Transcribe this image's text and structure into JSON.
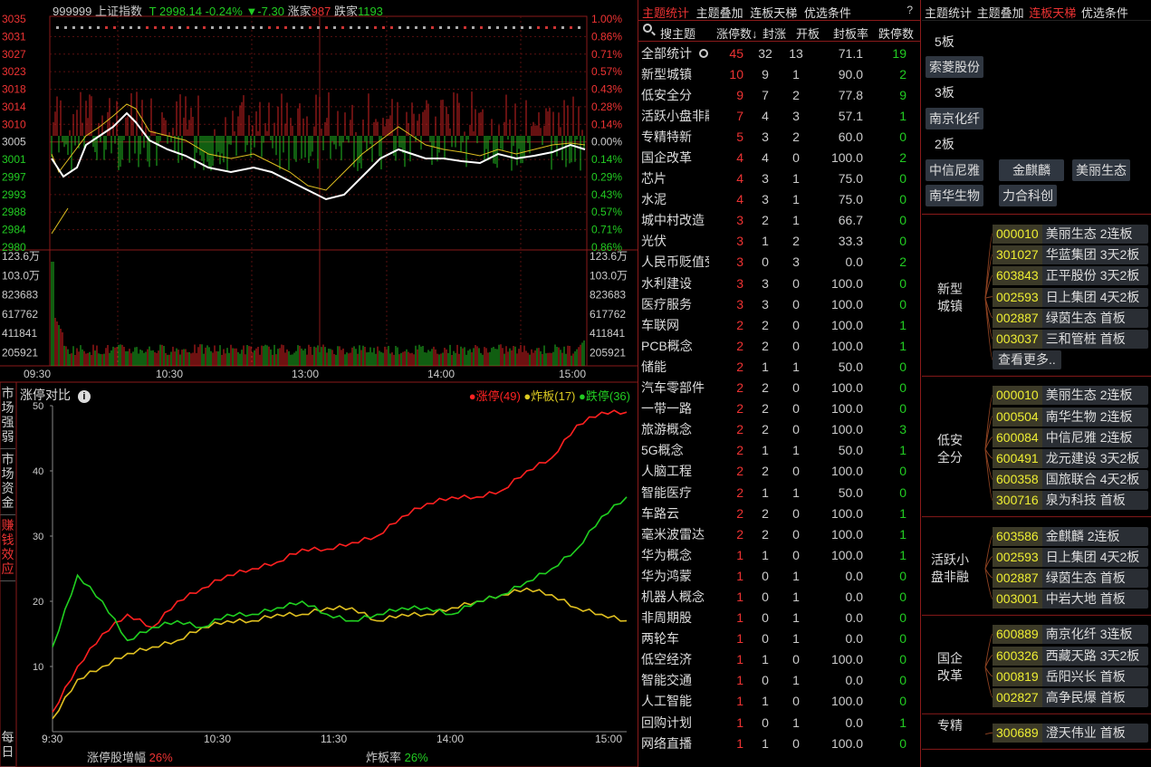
{
  "top_header": {
    "code": "999999",
    "name": "上证指数",
    "t": "T",
    "price": "2998.14",
    "pct": "-0.24%",
    "arrow": "▼",
    "chg": "-7.30",
    "up_label": "涨家",
    "up_count": "987",
    "down_label": "跌家",
    "down_count": "1193"
  },
  "price_axis": {
    "left": [
      "3035",
      "3031",
      "3027",
      "3023",
      "3018",
      "3014",
      "3010",
      "3005",
      "3001",
      "2997",
      "2993",
      "2988",
      "2984",
      "2980"
    ],
    "right": [
      "1.00%",
      "0.86%",
      "0.71%",
      "0.57%",
      "0.43%",
      "0.28%",
      "0.14%",
      "0.00%",
      "0.14%",
      "0.29%",
      "0.43%",
      "0.57%",
      "0.71%",
      "0.86%"
    ]
  },
  "volume_axis": {
    "left": [
      "123.6万",
      "103.0万",
      "823683",
      "617762",
      "411841",
      "205921"
    ],
    "right": [
      "123.6万",
      "103.0万",
      "823683",
      "617762",
      "411841",
      "205921"
    ]
  },
  "time_axis": [
    "09:30",
    "10:30",
    "13:00",
    "14:00",
    "15:00"
  ],
  "vtabs": [
    {
      "label": "市场强弱"
    },
    {
      "label": "市场资金"
    },
    {
      "label": "赚钱效应"
    },
    {
      "label": "每日"
    }
  ],
  "compare": {
    "title": "涨停对比",
    "legend": [
      {
        "name": "涨停(49)",
        "color": "#ff2020"
      },
      {
        "name": "炸板(17)",
        "color": "#e0c020"
      },
      {
        "name": "跌停(36)",
        "color": "#20d020"
      }
    ],
    "footer_left_label": "涨停股增幅",
    "footer_left_value": "26%",
    "footer_right_label": "炸板率",
    "footer_right_value": "26%"
  },
  "chart_data": {
    "type": "line",
    "title": "涨停对比",
    "x": [
      "9:30",
      "10:30",
      "11:30",
      "14:00",
      "15:00"
    ],
    "ylim": [
      0,
      50
    ],
    "yticks": [
      "10",
      "20",
      "30",
      "40",
      "50"
    ],
    "series": [
      {
        "name": "涨停(49)",
        "color": "#ff2020",
        "values": [
          3,
          10,
          15,
          18,
          16,
          20,
          22,
          24,
          25,
          26,
          28,
          28,
          29,
          30,
          33,
          35,
          36,
          36,
          37,
          40,
          42,
          47,
          49,
          49
        ]
      },
      {
        "name": "炸板(17)",
        "color": "#e0c020",
        "values": [
          2,
          8,
          10,
          12,
          13,
          14,
          16,
          17,
          17,
          18,
          18,
          19,
          19,
          17,
          18,
          18,
          19,
          20,
          21,
          22,
          21,
          19,
          18,
          17
        ]
      },
      {
        "name": "跌停(36)",
        "color": "#20d020",
        "values": [
          13,
          24,
          20,
          14,
          16,
          17,
          16,
          18,
          18,
          19,
          20,
          18,
          17,
          18,
          19,
          19,
          18,
          20,
          21,
          23,
          25,
          28,
          33,
          36
        ]
      }
    ]
  },
  "theme_panel": {
    "tabs": [
      "主题统计",
      "主题叠加",
      "连板天梯",
      "优选条件"
    ],
    "help": "?",
    "search_placeholder": "搜主题",
    "columns": [
      "涨停数↓",
      "封涨",
      "开板",
      "封板率",
      "跌停数"
    ],
    "rows": [
      {
        "name": "全部统计",
        "a": "45",
        "b": "32",
        "c": "13",
        "d": "71.1",
        "e": "19"
      },
      {
        "name": "新型城镇",
        "a": "10",
        "b": "9",
        "c": "1",
        "d": "90.0",
        "e": "2"
      },
      {
        "name": "低安全分",
        "a": "9",
        "b": "7",
        "c": "2",
        "d": "77.8",
        "e": "9"
      },
      {
        "name": "活跃小盘非融",
        "a": "7",
        "b": "4",
        "c": "3",
        "d": "57.1",
        "e": "1"
      },
      {
        "name": "专精特新",
        "a": "5",
        "b": "3",
        "c": "2",
        "d": "60.0",
        "e": "0"
      },
      {
        "name": "国企改革",
        "a": "4",
        "b": "4",
        "c": "0",
        "d": "100.0",
        "e": "2"
      },
      {
        "name": "芯片",
        "a": "4",
        "b": "3",
        "c": "1",
        "d": "75.0",
        "e": "0"
      },
      {
        "name": "水泥",
        "a": "4",
        "b": "3",
        "c": "1",
        "d": "75.0",
        "e": "0"
      },
      {
        "name": "城中村改造",
        "a": "3",
        "b": "2",
        "c": "1",
        "d": "66.7",
        "e": "0"
      },
      {
        "name": "光伏",
        "a": "3",
        "b": "1",
        "c": "2",
        "d": "33.3",
        "e": "0"
      },
      {
        "name": "人民币贬值受益",
        "a": "3",
        "b": "0",
        "c": "3",
        "d": "0.0",
        "e": "2"
      },
      {
        "name": "水利建设",
        "a": "3",
        "b": "3",
        "c": "0",
        "d": "100.0",
        "e": "0"
      },
      {
        "name": "医疗服务",
        "a": "3",
        "b": "3",
        "c": "0",
        "d": "100.0",
        "e": "0"
      },
      {
        "name": "车联网",
        "a": "2",
        "b": "2",
        "c": "0",
        "d": "100.0",
        "e": "1"
      },
      {
        "name": "PCB概念",
        "a": "2",
        "b": "2",
        "c": "0",
        "d": "100.0",
        "e": "1"
      },
      {
        "name": "储能",
        "a": "2",
        "b": "1",
        "c": "1",
        "d": "50.0",
        "e": "0"
      },
      {
        "name": "汽车零部件",
        "a": "2",
        "b": "2",
        "c": "0",
        "d": "100.0",
        "e": "0"
      },
      {
        "name": "一带一路",
        "a": "2",
        "b": "2",
        "c": "0",
        "d": "100.0",
        "e": "0"
      },
      {
        "name": "旅游概念",
        "a": "2",
        "b": "2",
        "c": "0",
        "d": "100.0",
        "e": "3"
      },
      {
        "name": "5G概念",
        "a": "2",
        "b": "1",
        "c": "1",
        "d": "50.0",
        "e": "1"
      },
      {
        "name": "人脑工程",
        "a": "2",
        "b": "2",
        "c": "0",
        "d": "100.0",
        "e": "0"
      },
      {
        "name": "智能医疗",
        "a": "2",
        "b": "1",
        "c": "1",
        "d": "50.0",
        "e": "0"
      },
      {
        "name": "车路云",
        "a": "2",
        "b": "2",
        "c": "0",
        "d": "100.0",
        "e": "1"
      },
      {
        "name": "毫米波雷达",
        "a": "2",
        "b": "2",
        "c": "0",
        "d": "100.0",
        "e": "1"
      },
      {
        "name": "华为概念",
        "a": "1",
        "b": "1",
        "c": "0",
        "d": "100.0",
        "e": "1"
      },
      {
        "name": "华为鸿蒙",
        "a": "1",
        "b": "0",
        "c": "1",
        "d": "0.0",
        "e": "0"
      },
      {
        "name": "机器人概念",
        "a": "1",
        "b": "0",
        "c": "1",
        "d": "0.0",
        "e": "0"
      },
      {
        "name": "非周期股",
        "a": "1",
        "b": "0",
        "c": "1",
        "d": "0.0",
        "e": "0"
      },
      {
        "name": "两轮车",
        "a": "1",
        "b": "0",
        "c": "1",
        "d": "0.0",
        "e": "0"
      },
      {
        "name": "低空经济",
        "a": "1",
        "b": "1",
        "c": "0",
        "d": "100.0",
        "e": "0"
      },
      {
        "name": "智能交通",
        "a": "1",
        "b": "0",
        "c": "1",
        "d": "0.0",
        "e": "0"
      },
      {
        "name": "人工智能",
        "a": "1",
        "b": "1",
        "c": "0",
        "d": "100.0",
        "e": "0"
      },
      {
        "name": "回购计划",
        "a": "1",
        "b": "0",
        "c": "1",
        "d": "0.0",
        "e": "1"
      },
      {
        "name": "网络直播",
        "a": "1",
        "b": "1",
        "c": "0",
        "d": "100.0",
        "e": "0"
      }
    ]
  },
  "ladder_panel": {
    "tabs": [
      "主题统计",
      "主题叠加",
      "连板天梯",
      "优选条件"
    ],
    "l5": "5板",
    "l5_stocks": [
      "索菱股份"
    ],
    "l3": "3板",
    "l3_stocks": [
      "南京化纤"
    ],
    "l2": "2板",
    "l2_stocks": [
      "中信尼雅",
      "金麒麟",
      "美丽生态",
      "南华生物",
      "力合科创"
    ],
    "groups": [
      {
        "name": "新型城镇",
        "more": "查看更多..",
        "items": [
          {
            "code": "000010",
            "name": "美丽生态",
            "label": "2连板"
          },
          {
            "code": "301027",
            "name": "华蓝集团",
            "label": "3天2板"
          },
          {
            "code": "603843",
            "name": "正平股份",
            "label": "3天2板"
          },
          {
            "code": "002593",
            "name": "日上集团",
            "label": "4天2板"
          },
          {
            "code": "002887",
            "name": "绿茵生态",
            "label": "首板"
          },
          {
            "code": "003037",
            "name": "三和管桩",
            "label": "首板"
          }
        ]
      },
      {
        "name": "低安全分",
        "items": [
          {
            "code": "000010",
            "name": "美丽生态",
            "label": "2连板"
          },
          {
            "code": "000504",
            "name": "南华生物",
            "label": "2连板"
          },
          {
            "code": "600084",
            "name": "中信尼雅",
            "label": "2连板"
          },
          {
            "code": "600491",
            "name": "龙元建设",
            "label": "3天2板"
          },
          {
            "code": "600358",
            "name": "国旅联合",
            "label": "4天2板"
          },
          {
            "code": "300716",
            "name": "泉为科技",
            "label": "首板"
          }
        ]
      },
      {
        "name": "活跃小盘非融",
        "items": [
          {
            "code": "603586",
            "name": "金麒麟",
            "label": "2连板"
          },
          {
            "code": "002593",
            "name": "日上集团",
            "label": "4天2板"
          },
          {
            "code": "002887",
            "name": "绿茵生态",
            "label": "首板"
          },
          {
            "code": "003001",
            "name": "中岩大地",
            "label": "首板"
          }
        ]
      },
      {
        "name": "国企改革",
        "items": [
          {
            "code": "600889",
            "name": "南京化纤",
            "label": "3连板"
          },
          {
            "code": "600326",
            "name": "西藏天路",
            "label": "3天2板"
          },
          {
            "code": "000819",
            "name": "岳阳兴长",
            "label": "首板"
          },
          {
            "code": "002827",
            "name": "高争民爆",
            "label": "首板"
          }
        ]
      },
      {
        "name": "专精",
        "items": [
          {
            "code": "300689",
            "name": "澄天伟业",
            "label": "首板"
          }
        ]
      }
    ]
  }
}
